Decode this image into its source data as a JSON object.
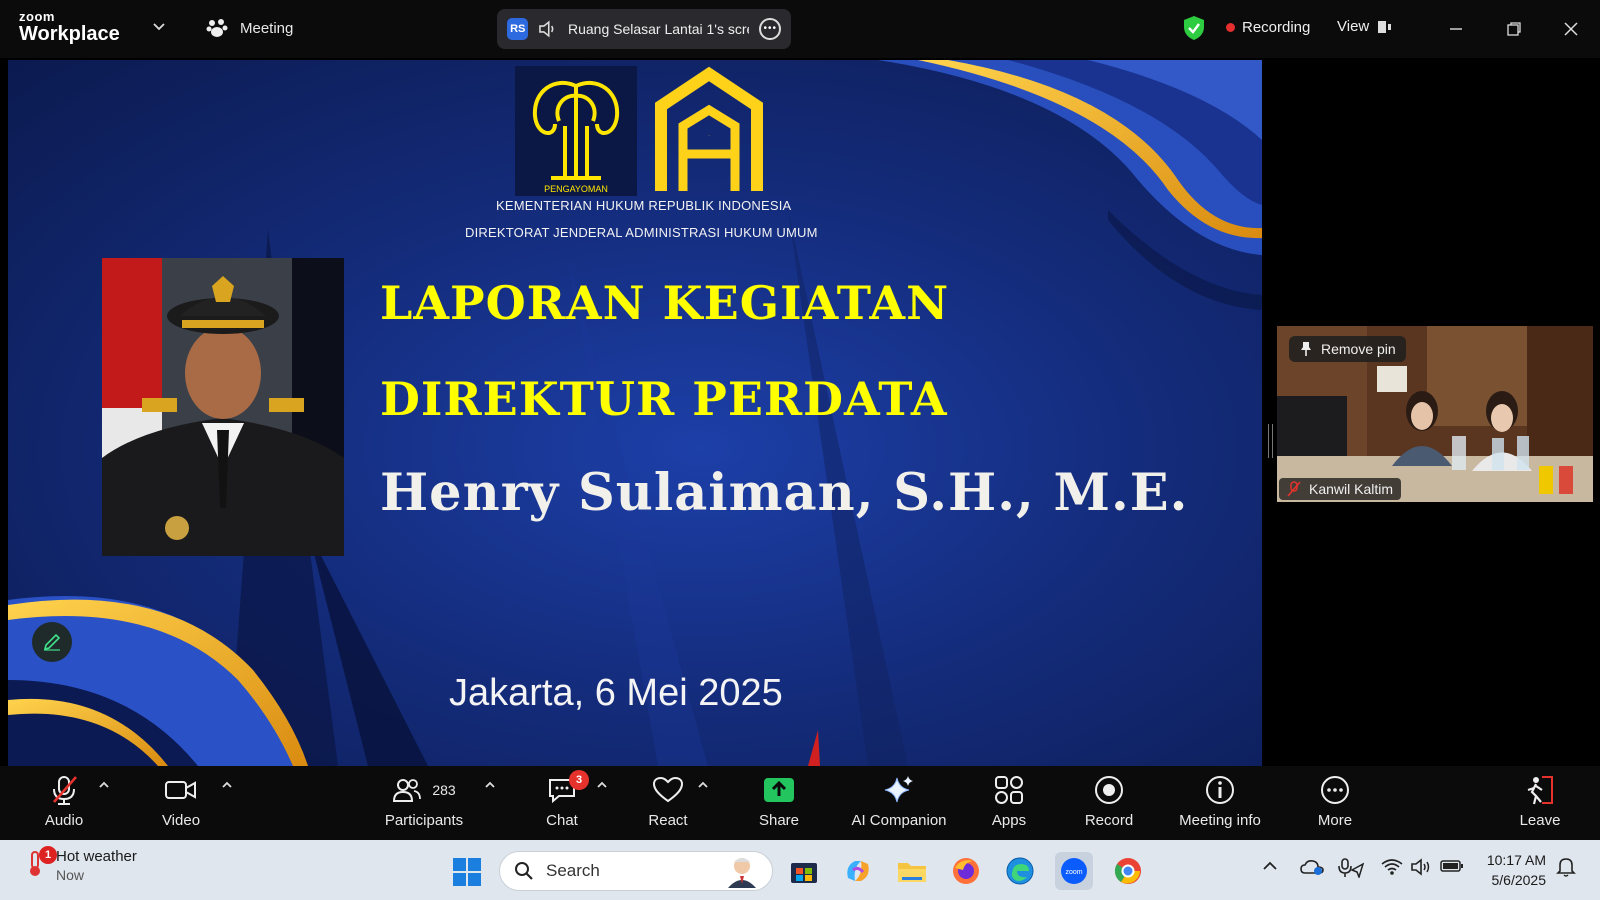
{
  "app": {
    "brand_top": "zoom",
    "brand_bottom": "Workplace"
  },
  "topbar": {
    "meeting_label": "Meeting",
    "share_badge": "RS",
    "share_text": "Ruang Selasar Lantai 1's screen",
    "recording_label": "Recording",
    "view_label": "View",
    "accent_colors": {
      "shield": "#2ecc40",
      "recording_dot": "#e52e2e",
      "share_badge": "#2d6ae0"
    }
  },
  "slide": {
    "emblem_caption": "PENGAYOMAN",
    "logo_text": "AHU",
    "org_line1": "KEMENTERIAN HUKUM REPUBLIK INDONESIA",
    "org_line2": "DIREKTORAT JENDERAL ADMINISTRASI HUKUM UMUM",
    "title_line1": "LAPORAN KEGIATAN",
    "title_line2": "DIREKTUR PERDATA",
    "presenter_name": "Henry Sulaiman, S.H., M.E.",
    "date_line": "Jakarta, 6 Mei 2025",
    "colors": {
      "title": "#ffff00",
      "gold": "#f5b51e",
      "navy": "#142c7c"
    }
  },
  "video_tile": {
    "remove_pin_label": "Remove pin",
    "participant_name": "Kanwil Kaltim"
  },
  "toolbar": {
    "audio": "Audio",
    "video": "Video",
    "participants": "Participants",
    "participants_count": "283",
    "chat": "Chat",
    "chat_badge": "3",
    "react": "React",
    "share": "Share",
    "ai_companion": "AI Companion",
    "apps": "Apps",
    "record": "Record",
    "meeting_info": "Meeting info",
    "more": "More",
    "leave": "Leave"
  },
  "taskbar": {
    "weather_title": "Hot weather",
    "weather_sub": "Now",
    "weather_badge": "1",
    "search_placeholder": "Search",
    "time": "10:17 AM",
    "date": "5/6/2025"
  }
}
